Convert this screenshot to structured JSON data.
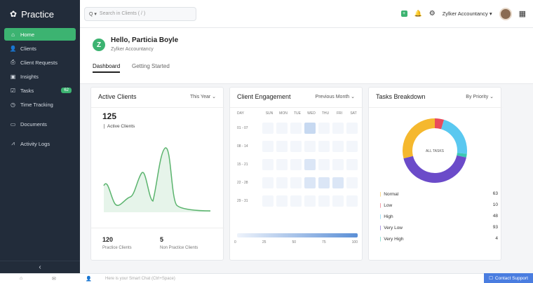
{
  "app": {
    "name": "Practice"
  },
  "sidebar": {
    "items": [
      {
        "label": "Home",
        "icon": "home-icon"
      },
      {
        "label": "Clients",
        "icon": "user-icon"
      },
      {
        "label": "Client Requests",
        "icon": "request-icon"
      },
      {
        "label": "Insights",
        "icon": "insights-icon"
      },
      {
        "label": "Tasks",
        "icon": "tasks-icon",
        "badge": "62"
      },
      {
        "label": "Time Tracking",
        "icon": "clock-icon"
      },
      {
        "label": "Documents",
        "icon": "folder-icon"
      },
      {
        "label": "Activity Logs",
        "icon": "activity-icon"
      }
    ],
    "collapse_glyph": "‹"
  },
  "topbar": {
    "search_scope": "Q ▾",
    "search_placeholder": "Search in Clients ( / )",
    "org_switcher": "Zylker Accountancy ▾"
  },
  "welcome": {
    "greeting": "Hello, Particia Boyle",
    "org": "Zylker Accountancy",
    "logo_letter": "Z",
    "tabs": [
      "Dashboard",
      "Getting Started"
    ]
  },
  "active_clients": {
    "title": "Active Clients",
    "filter": "This Year ⌄",
    "count": "125",
    "count_label": "Active Clients",
    "practice_count": "120",
    "practice_label": "Practice Clients",
    "non_practice_count": "5",
    "non_practice_label": "Non Practice Clients"
  },
  "client_engagement": {
    "title": "Client Engagement",
    "filter": "Previous Month ⌄",
    "day_headers": [
      "DAY",
      "SUN",
      "MON",
      "TUE",
      "WED",
      "THU",
      "FRI",
      "SAT"
    ],
    "weeks": [
      "01 - 07",
      "08 - 14",
      "15 - 21",
      "22 - 28",
      "29 - 31"
    ],
    "scale": [
      "0",
      "25",
      "50",
      "75",
      "100"
    ]
  },
  "tasks_breakdown": {
    "title": "Tasks Breakdown",
    "filter": "By Priority ⌄",
    "center_label": "ALL TASKS",
    "rows": [
      {
        "label": "Normal",
        "value": "63",
        "color": "#f5b82e"
      },
      {
        "label": "Low",
        "value": "10",
        "color": "#e94b5b"
      },
      {
        "label": "High",
        "value": "48",
        "color": "#5ac8f0"
      },
      {
        "label": "Very Low",
        "value": "93",
        "color": "#6b4bc9"
      },
      {
        "label": "Very High",
        "value": "4",
        "color": "#3cc7b3"
      }
    ]
  },
  "bottombar": {
    "chat_placeholder": "Here is your Smart Chat (Ctrl+Space)",
    "contact": "Contact Support"
  }
}
